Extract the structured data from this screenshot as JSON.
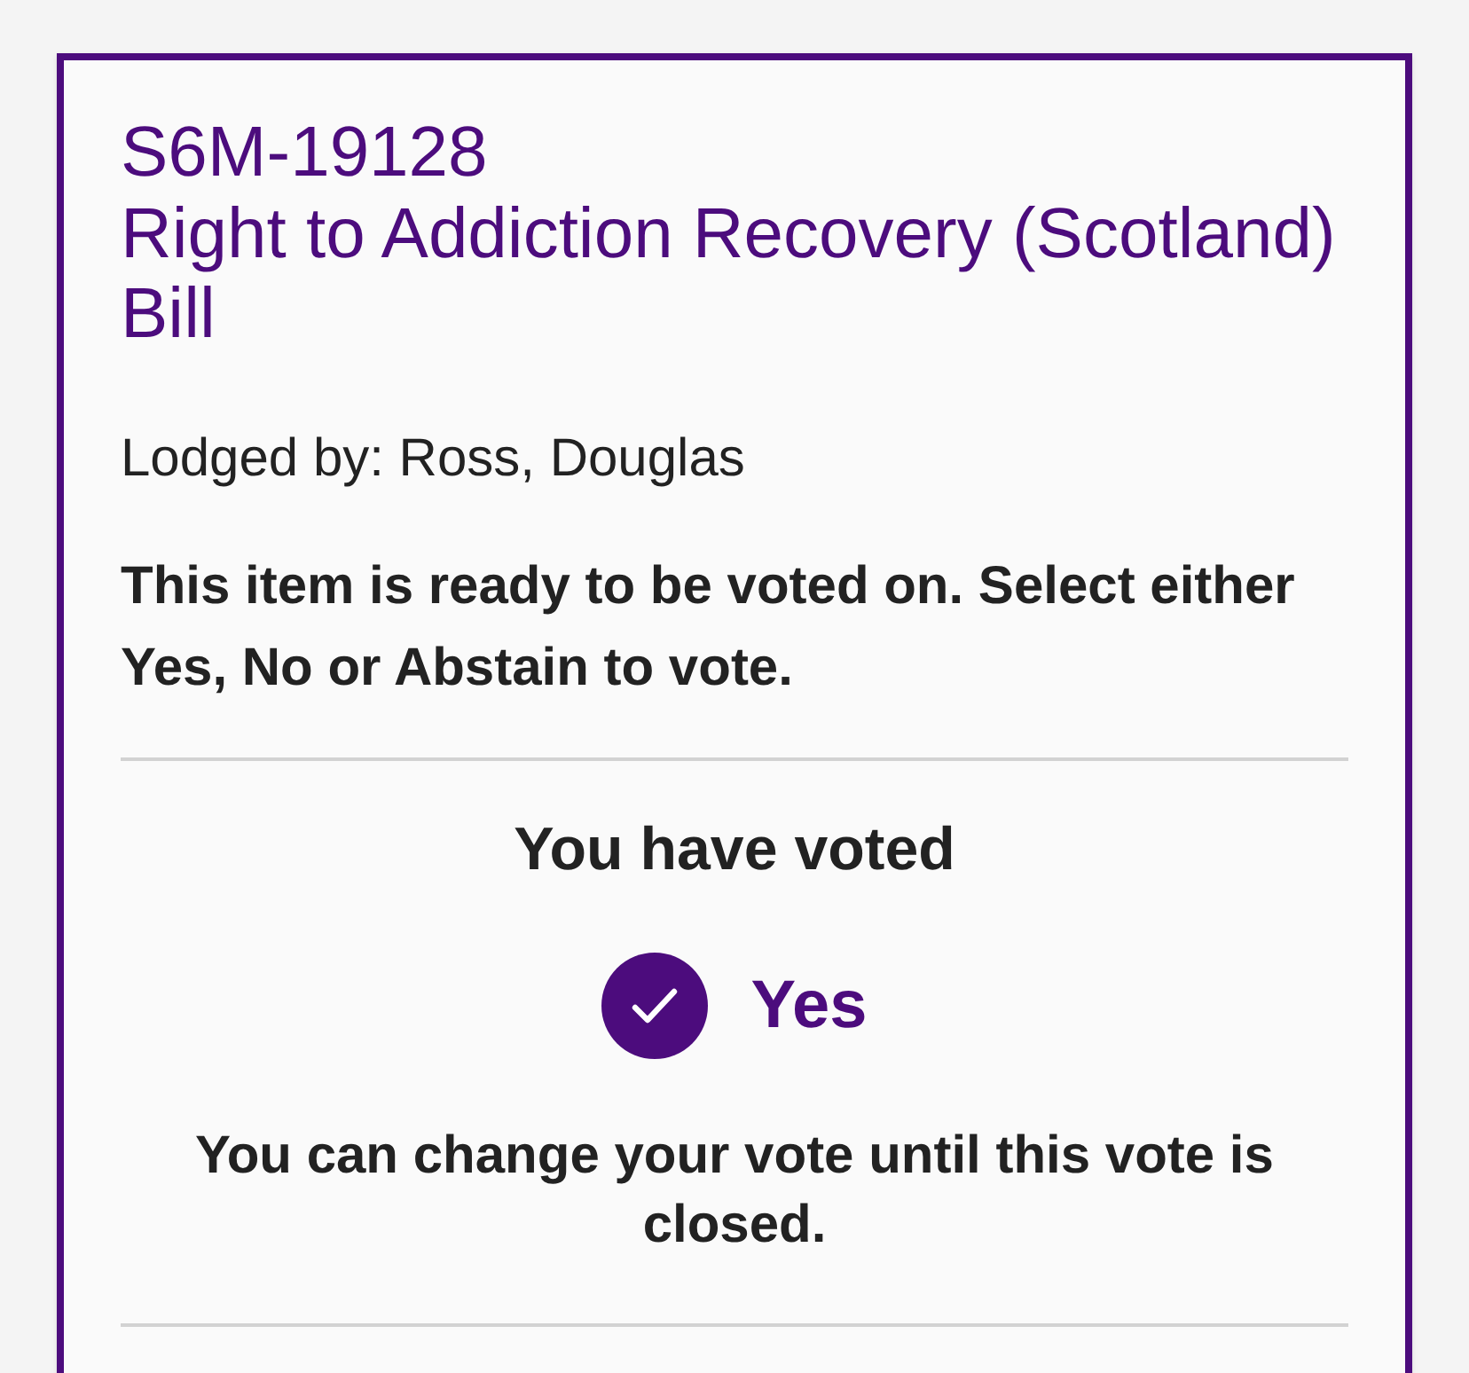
{
  "motion": {
    "reference": "S6M-19128",
    "title": "Right to Addiction Recovery (Scotland) Bill",
    "lodged_by": "Lodged by: Ross, Douglas",
    "instruction": "This item is ready to be voted on. Select either Yes, No or Abstain to vote."
  },
  "vote_status": {
    "heading": "You have voted",
    "choice": "Yes",
    "note": "You can change your vote until this vote is closed."
  }
}
